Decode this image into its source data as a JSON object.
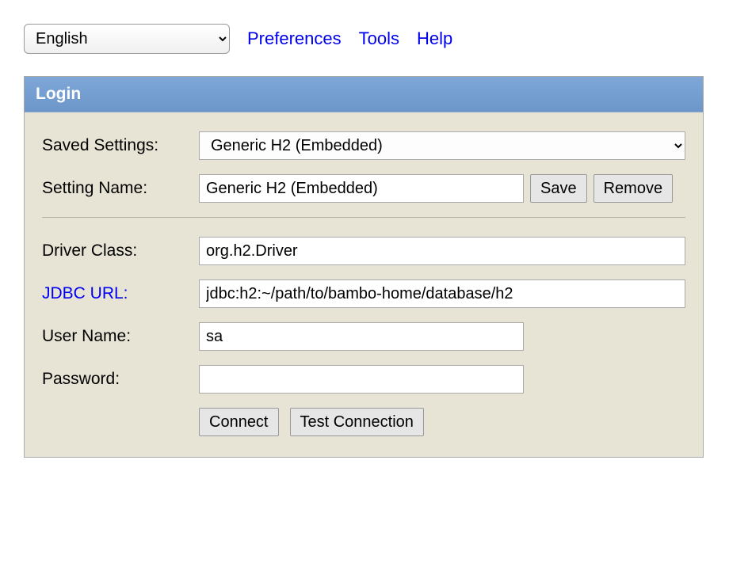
{
  "topbar": {
    "language": "English",
    "links": {
      "preferences": "Preferences",
      "tools": "Tools",
      "help": "Help"
    }
  },
  "panel": {
    "title": "Login"
  },
  "labels": {
    "saved_settings": "Saved Settings:",
    "setting_name": "Setting Name:",
    "driver_class": "Driver Class:",
    "jdbc_url": "JDBC URL:",
    "user_name": "User Name:",
    "password": "Password:"
  },
  "values": {
    "saved_settings_selected": "Generic H2 (Embedded)",
    "setting_name": "Generic H2 (Embedded)",
    "driver_class": "org.h2.Driver",
    "jdbc_url": "jdbc:h2:~/path/to/bambo-home/database/h2",
    "user_name": "sa",
    "password": ""
  },
  "buttons": {
    "save": "Save",
    "remove": "Remove",
    "connect": "Connect",
    "test_connection": "Test Connection"
  }
}
